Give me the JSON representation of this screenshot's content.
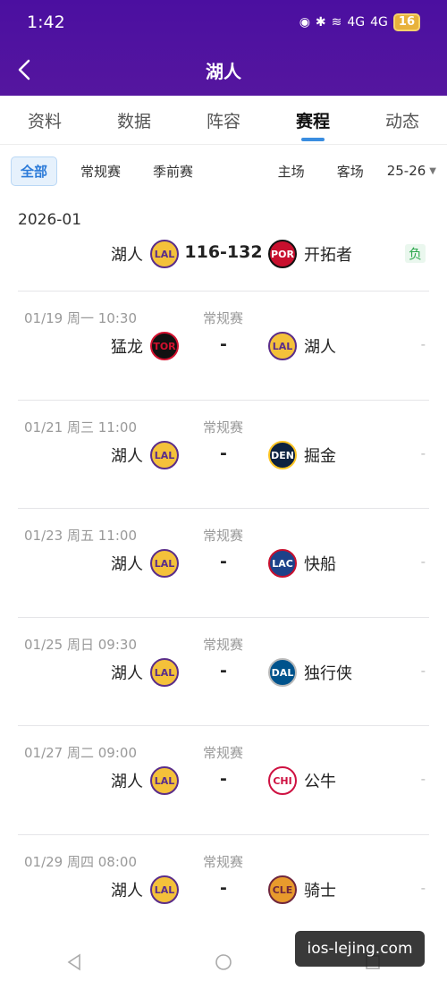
{
  "status_bar": {
    "time": "1:42",
    "signal1": "4G",
    "signal2": "4G",
    "battery": "16"
  },
  "nav": {
    "title": "湖人"
  },
  "tabs": [
    "资料",
    "数据",
    "阵容",
    "赛程",
    "动态"
  ],
  "active_tab": "赛程",
  "filters": {
    "all": "全部",
    "regular": "常规赛",
    "preseason": "季前赛",
    "home": "主场",
    "away": "客场",
    "season": "25-26"
  },
  "month": "2026-01",
  "matches": [
    {
      "date": "",
      "type": "",
      "home": "湖人",
      "home_logo": "LAL",
      "score": "116-132",
      "away": "开拓者",
      "away_logo": "POR",
      "result": "负"
    },
    {
      "date": "01/19 周一 10:30",
      "type": "常规赛",
      "home": "猛龙",
      "home_logo": "TOR",
      "score": "-",
      "away": "湖人",
      "away_logo": "LAL",
      "result": "-"
    },
    {
      "date": "01/21 周三 11:00",
      "type": "常规赛",
      "home": "湖人",
      "home_logo": "LAL",
      "score": "-",
      "away": "掘金",
      "away_logo": "DEN",
      "result": "-"
    },
    {
      "date": "01/23 周五 11:00",
      "type": "常规赛",
      "home": "湖人",
      "home_logo": "LAL",
      "score": "-",
      "away": "快船",
      "away_logo": "LAC",
      "result": "-"
    },
    {
      "date": "01/25 周日 09:30",
      "type": "常规赛",
      "home": "湖人",
      "home_logo": "LAL",
      "score": "-",
      "away": "独行侠",
      "away_logo": "DAL",
      "result": "-"
    },
    {
      "date": "01/27 周二 09:00",
      "type": "常规赛",
      "home": "湖人",
      "home_logo": "LAL",
      "score": "-",
      "away": "公牛",
      "away_logo": "CHI",
      "result": "-"
    },
    {
      "date": "01/29 周四 08:00",
      "type": "常规赛",
      "home": "湖人",
      "home_logo": "LAL",
      "score": "-",
      "away": "骑士",
      "away_logo": "CLE",
      "result": "-"
    }
  ],
  "watermark": "ios-lejing.com",
  "colors": {
    "header": "#4b0fa0",
    "accent": "#3a8de0",
    "lose": "#2fa84f"
  }
}
